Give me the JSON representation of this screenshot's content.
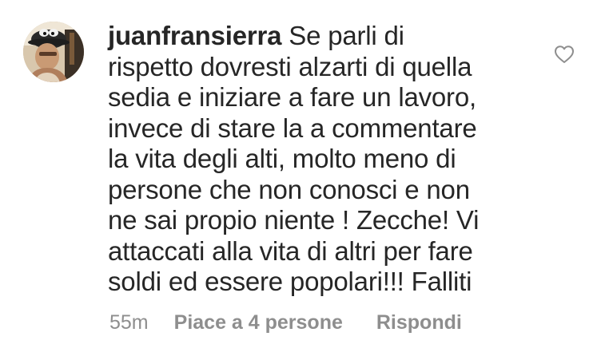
{
  "comment": {
    "username": "juanfransierra",
    "text": "Se parli di\nrispetto dovresti alzarti di quella\nsedia e iniziare a fare un lavoro,\ninvece di stare la a commentare\nla vita degli alti, molto meno di\npersone che non conosci e non\nne sai propio niente ! Zecche! Vi\nattaccati alla vita di altri per fare\nsoldi ed essere popolari!!! Falliti",
    "time": "55m",
    "likes_label": "Piace a 4 persone",
    "reply_label": "Rispondi",
    "like_icon": "heart-outline-icon"
  },
  "colors": {
    "text": "#262626",
    "meta": "#8e8e8e",
    "icon": "#8e8e8e"
  }
}
